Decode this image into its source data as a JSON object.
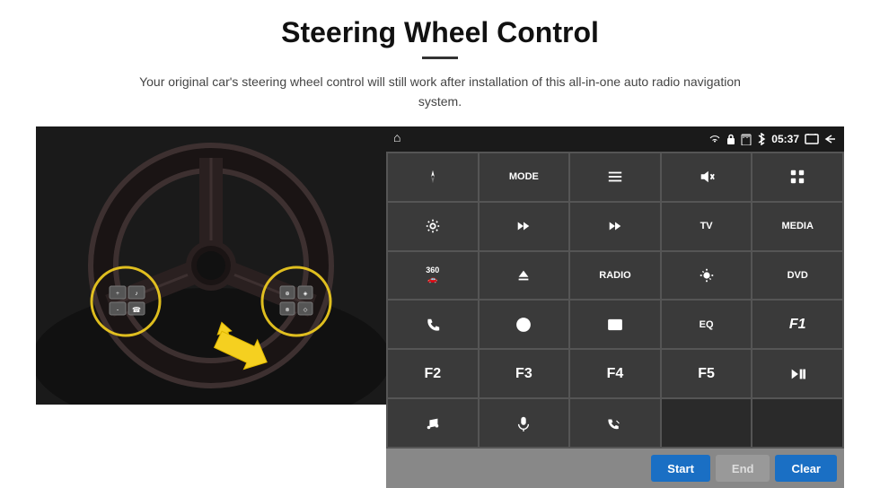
{
  "page": {
    "title": "Steering Wheel Control",
    "subtitle": "Your original car's steering wheel control will still work after installation of this all-in-one auto radio navigation system."
  },
  "status_bar": {
    "time": "05:37",
    "home_icon": "⌂"
  },
  "buttons": [
    {
      "id": "nav",
      "type": "icon",
      "icon": "arrow",
      "label": ""
    },
    {
      "id": "mode",
      "type": "text",
      "label": "MODE"
    },
    {
      "id": "list",
      "type": "icon",
      "icon": "list"
    },
    {
      "id": "mute",
      "type": "icon",
      "icon": "mute"
    },
    {
      "id": "apps",
      "type": "icon",
      "icon": "apps"
    },
    {
      "id": "settings",
      "type": "icon",
      "icon": "gear"
    },
    {
      "id": "rewind",
      "type": "icon",
      "icon": "rewind"
    },
    {
      "id": "forward",
      "type": "icon",
      "icon": "forward"
    },
    {
      "id": "tv",
      "type": "text",
      "label": "TV"
    },
    {
      "id": "media",
      "type": "text",
      "label": "MEDIA"
    },
    {
      "id": "360",
      "type": "text",
      "label": "360"
    },
    {
      "id": "eject",
      "type": "icon",
      "icon": "eject"
    },
    {
      "id": "radio",
      "type": "text",
      "label": "RADIO"
    },
    {
      "id": "brightness",
      "type": "icon",
      "icon": "brightness"
    },
    {
      "id": "dvd",
      "type": "text",
      "label": "DVD"
    },
    {
      "id": "phone",
      "type": "icon",
      "icon": "phone"
    },
    {
      "id": "compass",
      "type": "icon",
      "icon": "compass"
    },
    {
      "id": "screen",
      "type": "icon",
      "icon": "screen"
    },
    {
      "id": "eq",
      "type": "text",
      "label": "EQ"
    },
    {
      "id": "f1",
      "type": "text",
      "label": "F1"
    },
    {
      "id": "f2",
      "type": "text",
      "label": "F2"
    },
    {
      "id": "f3",
      "type": "text",
      "label": "F3"
    },
    {
      "id": "f4",
      "type": "text",
      "label": "F4"
    },
    {
      "id": "f5",
      "type": "text",
      "label": "F5"
    },
    {
      "id": "playpause",
      "type": "icon",
      "icon": "playpause"
    },
    {
      "id": "music",
      "type": "icon",
      "icon": "music"
    },
    {
      "id": "mic",
      "type": "icon",
      "icon": "mic"
    },
    {
      "id": "call",
      "type": "icon",
      "icon": "call"
    },
    {
      "id": "empty1",
      "type": "text",
      "label": ""
    },
    {
      "id": "empty2",
      "type": "text",
      "label": ""
    }
  ],
  "action_bar": {
    "start_label": "Start",
    "end_label": "End",
    "clear_label": "Clear"
  }
}
